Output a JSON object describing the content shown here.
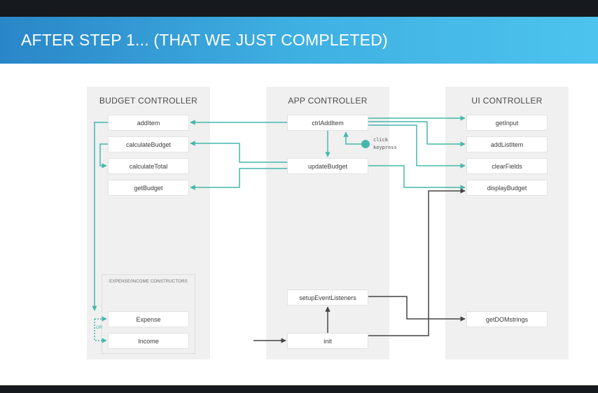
{
  "slide": {
    "title": "AFTER STEP 1... (THAT WE JUST COMPLETED)"
  },
  "panels": {
    "budget_controller": {
      "title": "BUDGET CONTROLLER",
      "items": [
        "addItem",
        "calculateBudget",
        "calculateTotal",
        "getBudget"
      ],
      "constructors": {
        "label": "EXPENSE/INCOME CONSTRUCTORS",
        "items": [
          "Expense",
          "Income"
        ],
        "or_label": "OR"
      }
    },
    "app_controller": {
      "title": "APP CONTROLLER",
      "items": [
        "ctrlAddItem",
        "updateBudget",
        "setupEventListeners",
        "init"
      ],
      "event_labels": [
        "click",
        "keypress"
      ]
    },
    "ui_controller": {
      "title": "UI CONTROLLER",
      "items": [
        "getInput",
        "addListItem",
        "clearFields",
        "displayBudget",
        "getDOMstrings"
      ]
    }
  },
  "colors": {
    "teal": "#43b8ab",
    "dark_arrow": "#444444",
    "header_start": "#2a86c8",
    "header_end": "#4cc3ee"
  }
}
